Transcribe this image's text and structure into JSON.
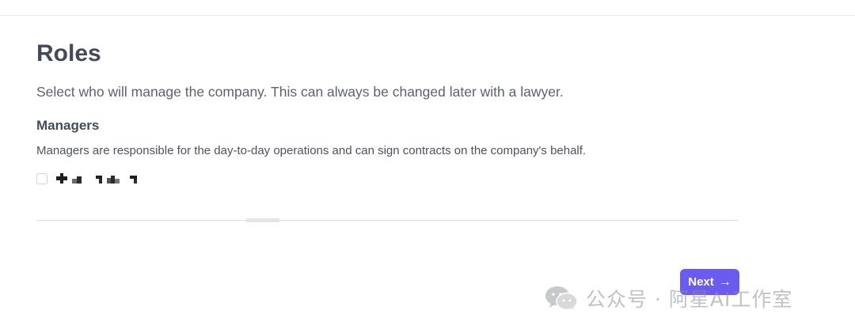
{
  "page": {
    "title": "Roles",
    "subtitle": "Select who will manage the company. This can always be changed later with a lawyer."
  },
  "managers": {
    "heading": "Managers",
    "description": "Managers are responsible for the day-to-day operations and can sign contracts on the company's behalf.",
    "options": [
      {
        "name_redacted": true,
        "checked": false
      }
    ]
  },
  "actions": {
    "next_label": "Next",
    "next_icon": "arrow-right-icon",
    "accent_color": "#6a5cf0"
  },
  "watermark": {
    "icon": "wechat-icon",
    "text": "公众号 · 阿星AI工作室"
  }
}
